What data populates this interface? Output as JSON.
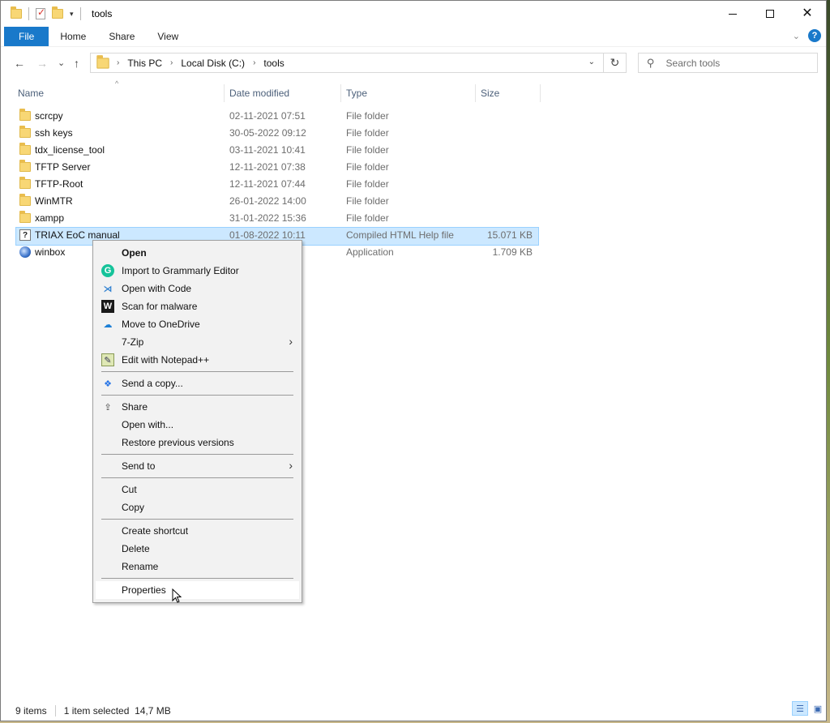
{
  "window": {
    "title": "tools"
  },
  "window_controls": {
    "minimize": "—",
    "maximize": "☐",
    "close": "✕"
  },
  "ribbon": {
    "tabs": [
      "File",
      "Home",
      "Share",
      "View"
    ]
  },
  "navigation": {
    "back": "←",
    "forward": "→",
    "recent": "⌄",
    "up": "↑",
    "breadcrumbs": [
      "This PC",
      "Local Disk (C:)",
      "tools"
    ],
    "refresh": "↻"
  },
  "search": {
    "placeholder": "Search tools"
  },
  "columns": [
    "Name",
    "Date modified",
    "Type",
    "Size"
  ],
  "files": [
    {
      "name": "scrcpy",
      "date": "02-11-2021 07:51",
      "type": "File folder",
      "size": "",
      "icon": "folder-icon"
    },
    {
      "name": "ssh keys",
      "date": "30-05-2022 09:12",
      "type": "File folder",
      "size": "",
      "icon": "folder-icon"
    },
    {
      "name": "tdx_license_tool",
      "date": "03-11-2021 10:41",
      "type": "File folder",
      "size": "",
      "icon": "folder-icon"
    },
    {
      "name": "TFTP Server",
      "date": "12-11-2021 07:38",
      "type": "File folder",
      "size": "",
      "icon": "folder-icon"
    },
    {
      "name": "TFTP-Root",
      "date": "12-11-2021 07:44",
      "type": "File folder",
      "size": "",
      "icon": "folder-icon"
    },
    {
      "name": "WinMTR",
      "date": "26-01-2022 14:00",
      "type": "File folder",
      "size": "",
      "icon": "folder-icon"
    },
    {
      "name": "xampp",
      "date": "31-01-2022 15:36",
      "type": "File folder",
      "size": "",
      "icon": "folder-icon"
    },
    {
      "name": "TRIAX EoC manual",
      "date": "01-08-2022 10:11",
      "type": "Compiled HTML Help file",
      "size": "15.071 KB",
      "icon": "help-file-icon",
      "selected": true
    },
    {
      "name": "winbox",
      "date": "",
      "type": "Application",
      "size": "1.709 KB",
      "icon": "application-icon"
    }
  ],
  "context_menu": {
    "items": [
      {
        "label": "Open",
        "bold": true
      },
      {
        "label": "Import to Grammarly Editor",
        "icon": "grammarly-icon"
      },
      {
        "label": "Open with Code",
        "icon": "vscode-icon"
      },
      {
        "label": "Scan for malware",
        "icon": "malware-scan-icon"
      },
      {
        "label": "Move to OneDrive",
        "icon": "onedrive-icon"
      },
      {
        "label": "7-Zip",
        "submenu": true
      },
      {
        "label": "Edit with Notepad++",
        "icon": "notepad-plus-plus-icon"
      },
      {
        "label": "Send a copy...",
        "icon": "dropbox-icon"
      },
      {
        "label": "Share",
        "icon": "share-icon"
      },
      {
        "label": "Open with..."
      },
      {
        "label": "Restore previous versions"
      },
      {
        "label": "Send to",
        "submenu": true
      },
      {
        "label": "Cut"
      },
      {
        "label": "Copy"
      },
      {
        "label": "Create shortcut"
      },
      {
        "label": "Delete"
      },
      {
        "label": "Rename"
      },
      {
        "label": "Properties",
        "hover": true
      }
    ]
  },
  "status": {
    "item_count": "9 items",
    "selection": "1 item selected  14,7 MB"
  },
  "colors": {
    "accent": "#1979ca",
    "selection": "#cce8ff",
    "selection_border": "#99d1ff",
    "menu_bg": "#f2f2f2"
  }
}
